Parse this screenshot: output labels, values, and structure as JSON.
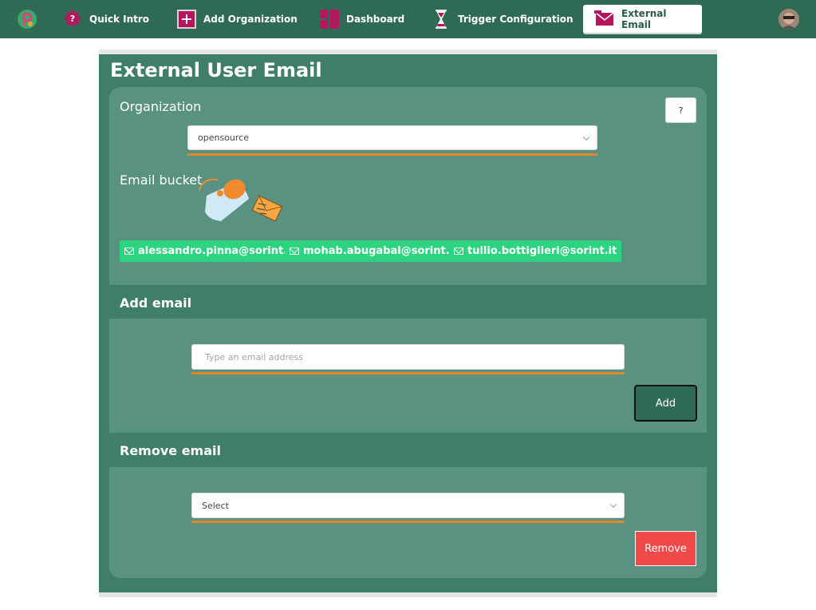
{
  "nav": {
    "items": [
      {
        "label": "Quick Intro",
        "icon": "question-icon"
      },
      {
        "label": "Add Organization",
        "icon": "plus-box-icon"
      },
      {
        "label": "Dashboard",
        "icon": "dashboard-icon"
      },
      {
        "label": "Trigger Configuration",
        "icon": "hourglass-icon"
      },
      {
        "label": "External Email",
        "icon": "envelope-icon",
        "active": true
      }
    ]
  },
  "page": {
    "title": "External User Email"
  },
  "organization": {
    "label": "Organization",
    "help_label": "?",
    "selected": "opensource"
  },
  "bucket": {
    "label": "Email bucket",
    "emails": [
      "alessandro.pinna@sorint.it",
      "mohab.abugabal@sorint.it",
      "tullio.bottiglieri@sorint.it"
    ]
  },
  "add_email": {
    "title": "Add email",
    "placeholder": "Type an email address",
    "button_label": "Add"
  },
  "remove_email": {
    "title": "Remove email",
    "select_value": "Select",
    "button_label": "Remove"
  },
  "colors": {
    "topbar": "#2f6b54",
    "panel": "#3f7f69",
    "card": "#5a9281",
    "accent_orange": "#e8872a",
    "tag_green": "#2dd47f",
    "remove_red": "#ef4949"
  }
}
